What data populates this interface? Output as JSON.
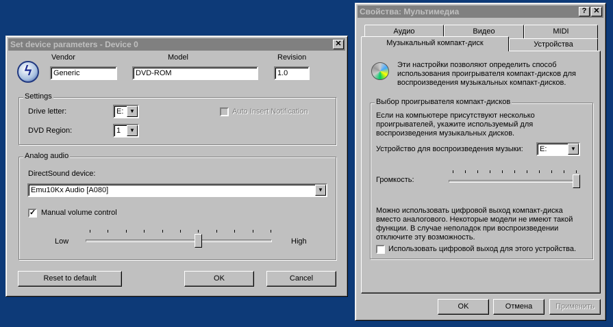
{
  "left_dialog": {
    "title": "Set device parameters - Device 0",
    "vendor_label": "Vendor",
    "vendor_value": "Generic",
    "model_label": "Model",
    "model_value": "DVD-ROM",
    "revision_label": "Revision",
    "revision_value": "1.0",
    "settings_label": "Settings",
    "drive_letter_label": "Drive letter:",
    "drive_letter_value": "E:",
    "dvd_region_label": "DVD Region:",
    "dvd_region_value": "1",
    "auto_insert_label": "Auto Insert Notification",
    "analog_label": "Analog audio",
    "directsound_label": "DirectSound device:",
    "directsound_value": "Emu10Kx Audio [A080]",
    "manual_volume_label": "Manual volume control",
    "manual_volume_checked": true,
    "low_label": "Low",
    "high_label": "High",
    "volume_fraction": 0.6,
    "reset_label": "Reset to default",
    "ok_label": "OK",
    "cancel_label": "Cancel"
  },
  "right_dialog": {
    "title": "Свойства: Мультимедиа",
    "help_icon": "?",
    "tabs": [
      "Аудио",
      "Видео",
      "MIDI",
      "Музыкальный компакт-диск",
      "Устройства"
    ],
    "intro": "Эти настройки позволяют определить способ использования проигрывателя компакт-дисков для воспроизведения музыкальных компакт-дисков.",
    "group_label": "Выбор проигрывателя компакт-дисков",
    "group_text": "Если на компьютере присутствуют несколько проигрывателей, укажите используемый для воспроизведения музыкальных дисков.",
    "device_label": "Устройство для воспроизведения музыки:",
    "device_value": "E:",
    "volume_label": "Громкость:",
    "volume_fraction": 1.0,
    "digital_text": "Можно использовать цифровой выход компакт-диска вместо аналогового. Некоторые модели не имеют такой функции. В случае неполадок при воспроизведении отключите эту возможность.",
    "digital_checkbox_label": "Использовать цифровой выход для этого устройства.",
    "ok_label": "OK",
    "cancel_label": "Отмена",
    "apply_label": "Применить"
  }
}
